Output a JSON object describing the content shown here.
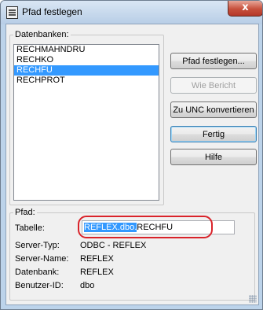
{
  "window": {
    "title": "Pfad festlegen",
    "close_glyph": "x"
  },
  "databases": {
    "legend": "Datenbanken:",
    "items": [
      "RECHMAHNDRU",
      "RECHKO",
      "RECHFU",
      "RECHPROT"
    ],
    "selected": "RECHFU"
  },
  "buttons": {
    "pfad_festlegen": "Pfad festlegen...",
    "wie_bericht": "Wie Bericht",
    "zu_unc": "Zu UNC konvertieren",
    "fertig": "Fertig",
    "hilfe": "Hilfe"
  },
  "pfad": {
    "legend": "Pfad:",
    "tabelle_label": "Tabelle:",
    "tabelle_selected": "REFLEX.dbo.",
    "tabelle_rest": "RECHFU",
    "server_typ_label": "Server-Typ:",
    "server_typ": "ODBC - REFLEX",
    "server_name_label": "Server-Name:",
    "server_name": "REFLEX",
    "datenbank_label": "Datenbank:",
    "datenbank": "REFLEX",
    "benutzer_label": "Benutzer-ID:",
    "benutzer": "dbo"
  },
  "colors": {
    "selection": "#3399ff",
    "annotation_ring": "#d9232a"
  }
}
